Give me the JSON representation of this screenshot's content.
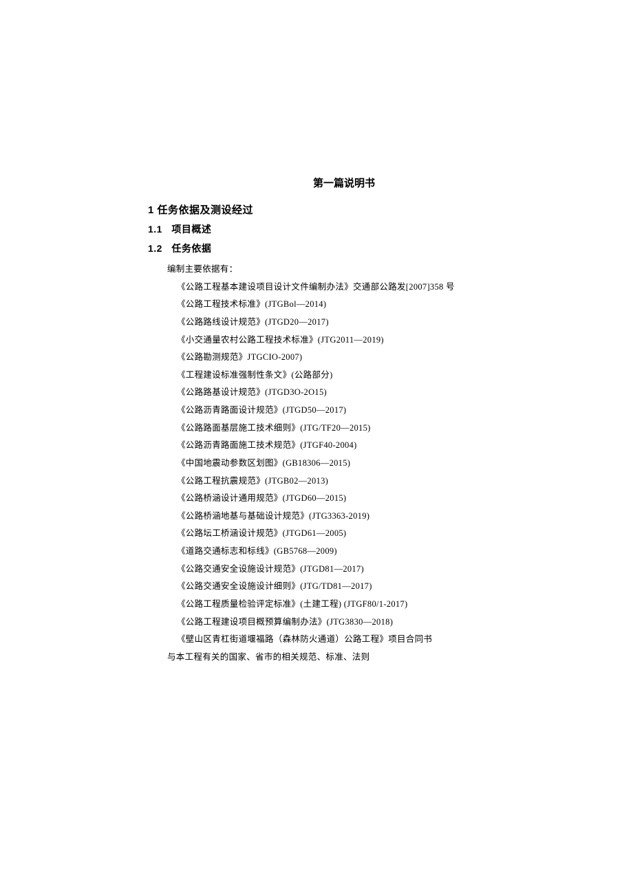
{
  "doc_title": "第一篇说明书",
  "h1_1": "1 任务依据及测设经过",
  "h2_1": {
    "num": "1.1",
    "label": "项目概述"
  },
  "h2_2": {
    "num": "1.2",
    "label": "任务依据"
  },
  "intro": "编制主要依据有：",
  "references": [
    "《公路工程基本建设项目设计文件编制办法》交通部公路发[2007]358 号",
    "《公路工程技术标准》(JTGBol—2014)",
    "《公路路线设计规范》(JTGD20—2017)",
    "《小交通量农村公路工程技术标准》(JTG2011—2019)",
    "《公路勘测规范》JTGCIO-2007)",
    "《工程建设标准强制性条文》(公路部分)",
    "《公路路基设计规范》(JTGD3O-2O15)",
    "《公路沥青路面设计规范》(JTGD50—2017)",
    "《公路路面基层施工技术细则》(JTG/TF20—2015)",
    "《公路沥青路面施工技术规范》(JTGF40-2004)",
    "《中国地震动参数区划图》(GB18306—2015)",
    "《公路工程抗震规范》(JTGB02—2013)",
    "《公路桥涵设计通用规范》(JTGD60—2015)",
    "《公路桥涵地基与基础设计规范》(JTG3363-2019)",
    "《公路坛工桥涵设计规范》(JTGD61—2005)",
    "《道路交通标志和标线》(GB5768—2009)",
    "《公路交通安全设施设计规范》(JTGD81—2017)",
    "《公路交通安全设施设计细则》(JTG/TD81—2017)",
    "《公路工程质量检验评定标准》(土建工程) (JTGF80/1-2017)",
    "《公路工程建设项目概预算编制办法》(JTG3830—2018)",
    "《壁山区青杠街道堰福路（森林防火通道）公路工程》项目合同书"
  ],
  "closing": "与本工程有关的国家、省市的相关规范、标准、法则"
}
